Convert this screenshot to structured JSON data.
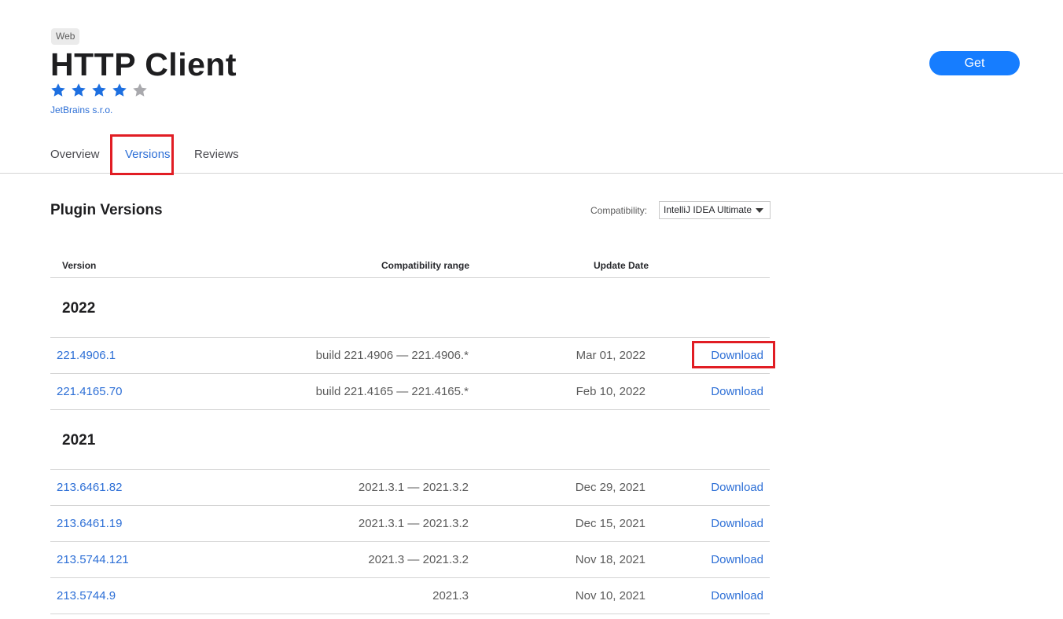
{
  "header": {
    "category_tag": "Web",
    "title": "HTTP Client",
    "rating": {
      "filled": 4,
      "total": 5
    },
    "vendor": "JetBrains s.r.o.",
    "get_label": "Get"
  },
  "tabs": [
    {
      "label": "Overview",
      "active": false
    },
    {
      "label": "Versions",
      "active": true
    },
    {
      "label": "Reviews",
      "active": false
    }
  ],
  "versions": {
    "section_title": "Plugin Versions",
    "compat_label": "Compatibility:",
    "compat_selected": "IntelliJ IDEA Ultimate",
    "columns": [
      "Version",
      "Compatibility range",
      "Update Date"
    ],
    "groups": [
      {
        "year": "2022",
        "rows": [
          {
            "version": "221.4906.1",
            "range": "build 221.4906 — 221.4906.*",
            "date": "Mar 01, 2022",
            "action": "Download"
          },
          {
            "version": "221.4165.70",
            "range": "build 221.4165 — 221.4165.*",
            "date": "Feb 10, 2022",
            "action": "Download"
          }
        ]
      },
      {
        "year": "2021",
        "rows": [
          {
            "version": "213.6461.82",
            "range": "2021.3.1 — 2021.3.2",
            "date": "Dec 29, 2021",
            "action": "Download"
          },
          {
            "version": "213.6461.19",
            "range": "2021.3.1 — 2021.3.2",
            "date": "Dec 15, 2021",
            "action": "Download"
          },
          {
            "version": "213.5744.121",
            "range": "2021.3 — 2021.3.2",
            "date": "Nov 18, 2021",
            "action": "Download"
          },
          {
            "version": "213.5744.9",
            "range": "2021.3",
            "date": "Nov 10, 2021",
            "action": "Download"
          }
        ]
      }
    ]
  },
  "colors": {
    "accent": "#167dff",
    "link": "#2d6fd6",
    "highlight": "#e11d24",
    "star_filled": "#1d6fe0",
    "star_empty": "#a9a9ad"
  }
}
